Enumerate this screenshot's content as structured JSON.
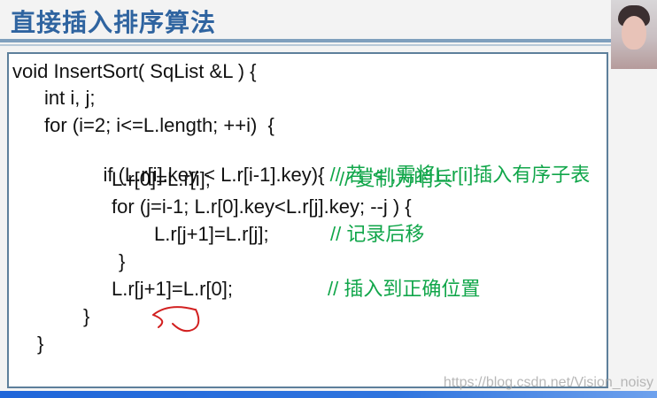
{
  "slide": {
    "title": "直接插入排序算法"
  },
  "code": {
    "line1": "void InsertSort( SqList &L ) {",
    "line2": "int i, j;",
    "line3": "for (i=2; i<=L.length; ++i)  {",
    "line4_code": "if (L.r[i].key < L.r[i-1].key){",
    "line4_comment": " // 若\"<\",需将L.r[i]插入有序子表",
    "line5_code": "L.r[0]=L.r[i];",
    "line5_comment": "// 复制为哨兵",
    "line6": "for (j=i-1; L.r[0].key<L.r[j].key; --j ) {",
    "line7_code": "L.r[j+1]=L.r[j];",
    "line7_comment": "// 记录后移",
    "line8": "}",
    "line9_code": "L.r[j+1]=L.r[0];",
    "line9_comment": "// 插入到正确位置",
    "line10": "}",
    "line11": "}"
  },
  "watermark": {
    "text": "https://blog.csdn.net/Vision_noisy"
  },
  "colors": {
    "title": "#2f64a0",
    "comment": "#11a64a",
    "panel_border": "#5d7f9b",
    "annotation": "#d22020"
  }
}
